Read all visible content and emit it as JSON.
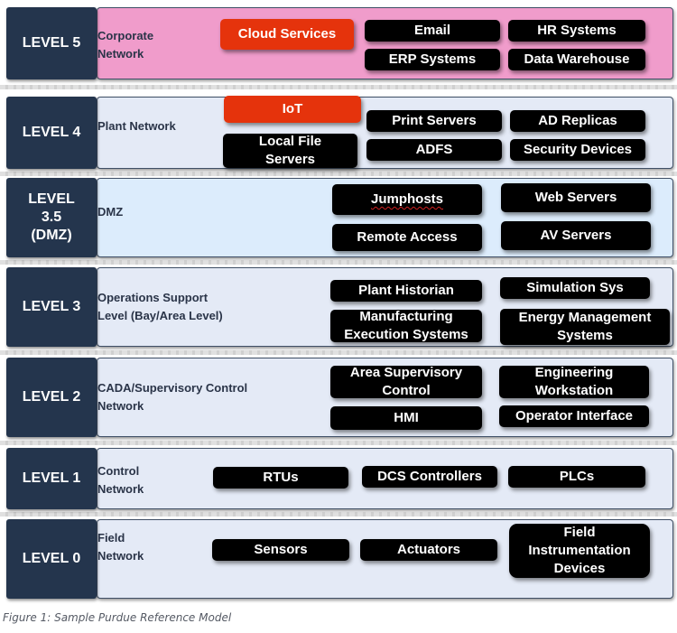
{
  "figure_caption": "Figure 1: Sample Purdue Reference Model",
  "colors": {
    "level_label_bg": "#24354d",
    "corporate_panel_bg": "#f09ccb",
    "dmz_panel_bg": "#dcecfc",
    "default_panel_bg": "#e4eaf6",
    "component_box_bg": "#000000",
    "highlight_box_bg": "#e5330c"
  },
  "levels": [
    {
      "label": "LEVEL 5",
      "network": "Corporate\nNetwork",
      "components": [
        "Cloud Services",
        "Email",
        "HR Systems",
        "ERP Systems",
        "Data Warehouse"
      ],
      "highlighted": [
        "Cloud Services"
      ]
    },
    {
      "label": "LEVEL 4",
      "network": "Plant Network",
      "components": [
        "IoT",
        "Print Servers",
        "AD Replicas",
        "Local File\nServers",
        "ADFS",
        "Security Devices"
      ],
      "highlighted": [
        "IoT"
      ]
    },
    {
      "label": "LEVEL\n3.5\n(DMZ)",
      "network": "DMZ",
      "components": [
        "Jumphosts",
        "Web Servers",
        "Remote Access",
        "AV Servers"
      ],
      "highlighted": []
    },
    {
      "label": "LEVEL 3",
      "network": "Operations Support\nLevel (Bay/Area Level)",
      "components": [
        "Plant Historian",
        "Simulation Sys",
        "Manufacturing\nExecution Systems",
        "Energy Management\nSystems"
      ],
      "highlighted": []
    },
    {
      "label": "LEVEL 2",
      "network": "CADA/Supervisory Control\nNetwork",
      "components": [
        "Area Supervisory\nControl",
        "Engineering\nWorkstation",
        "HMI",
        "Operator Interface"
      ],
      "highlighted": []
    },
    {
      "label": "LEVEL 1",
      "network": "Control\nNetwork",
      "components": [
        "RTUs",
        "DCS Controllers",
        "PLCs"
      ],
      "highlighted": []
    },
    {
      "label": "LEVEL 0",
      "network": "Field\nNetwork",
      "components": [
        "Sensors",
        "Actuators",
        "Field\nInstrumentation\nDevices"
      ],
      "highlighted": []
    }
  ]
}
